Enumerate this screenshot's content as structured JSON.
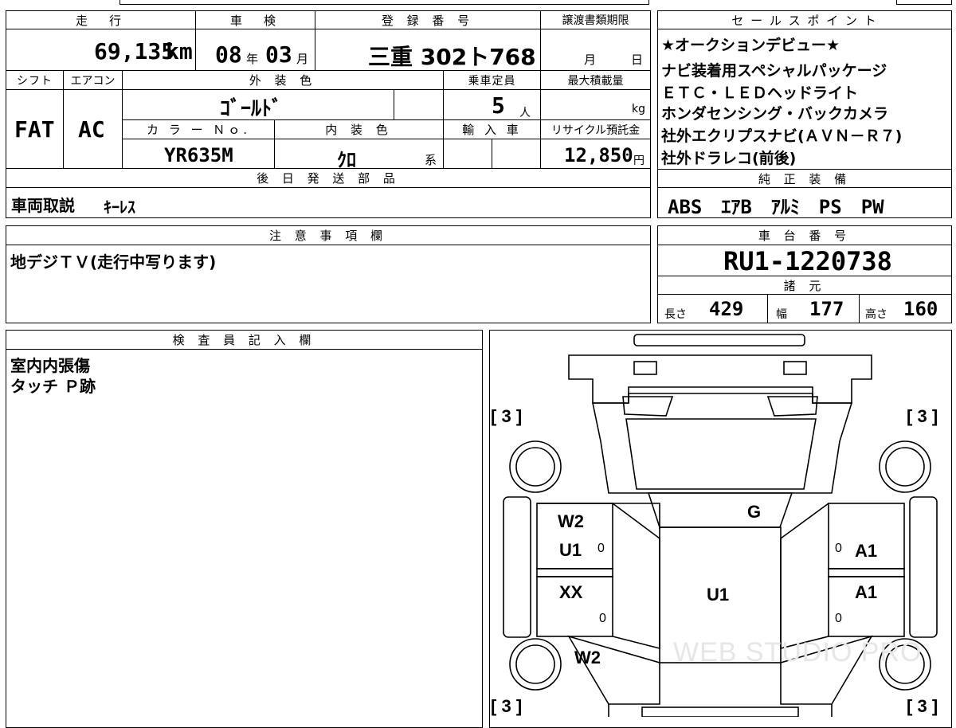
{
  "top_table": {
    "headers": {
      "mileage": "走　行",
      "inspection": "車　検",
      "plate": "登 録 番 号",
      "transfer_deadline": "譲渡書類期限",
      "shift": "シフト",
      "aircon": "エアコン",
      "exterior_color": "外 装 色",
      "capacity": "乗車定員",
      "max_load": "最大積載量",
      "color_no": "カ ラ ー Ｎｏ.",
      "interior_color": "内 装 色",
      "import": "輸 入 車",
      "recycle": "リサイクル預託金"
    },
    "mileage": "69,135",
    "mileage_unit": "km",
    "inspection_year": "08",
    "year_unit": "年",
    "inspection_month": "03",
    "month_unit": "月",
    "plate_number": "三重 302ト768",
    "deadline_month_unit": "月",
    "deadline_day_unit": "日",
    "shift_value": "FAT",
    "aircon_value": "AC",
    "exterior_color_value": "ｺﾞｰﾙﾄﾞ",
    "capacity_value": "5",
    "capacity_unit": "人",
    "max_load_unit": "kg",
    "color_no_value": "YR635M",
    "interior_color_value": "ｸﾛ",
    "interior_color_suffix": "系",
    "recycle_value": "12,850",
    "recycle_unit": "円",
    "later_parts_header": "後 日 発 送 部 品",
    "later_parts_value": "車両取説",
    "later_parts_extra": "ｷｰﾚｽ"
  },
  "sales_points": {
    "header": "セ ー ル ス ポ イ ン ト",
    "lines": [
      "★オークションデビュー★",
      "ナビ装着用スペシャルパッケージ",
      "ＥＴＣ・ＬＥＤヘッドライト",
      "ホンダセンシング・バックカメラ",
      "社外エクリプスナビ(ＡＶＮ－Ｒ７)",
      "社外ドラレコ(前後)"
    ]
  },
  "standard_equipment": {
    "header": "純 正 装 備",
    "items": "ABS　ｴｱB　ｱﾙﾐ　PS　PW"
  },
  "notes": {
    "header": "注 意 事 項 欄",
    "text": "地デジＴＶ(走行中写ります)"
  },
  "chassis": {
    "header": "車 台 番 号",
    "number": "RU1-1220738"
  },
  "specs": {
    "header": "諸 元",
    "length_label": "長さ",
    "length": "429",
    "width_label": "幅",
    "width": "177",
    "height_label": "高さ",
    "height": "160"
  },
  "inspector": {
    "header": "検 査 員 記 入 欄",
    "lines": [
      "室内内張傷",
      "タッチ Ｐ跡"
    ]
  },
  "diagram": {
    "tire_marks": {
      "front_left": "3",
      "front_right": "3",
      "rear_left": "3",
      "rear_right": "3"
    },
    "marks": {
      "left_front_door_1": "W2",
      "left_front_door_2": "U1",
      "left_rear_door": "XX",
      "left_rear_quarter": "W2",
      "windshield": "G",
      "roof": "U1",
      "right_front_door": "A1",
      "right_rear_door": "A1"
    },
    "zero": "0",
    "watermark": "WEB STUDIO PRO"
  }
}
